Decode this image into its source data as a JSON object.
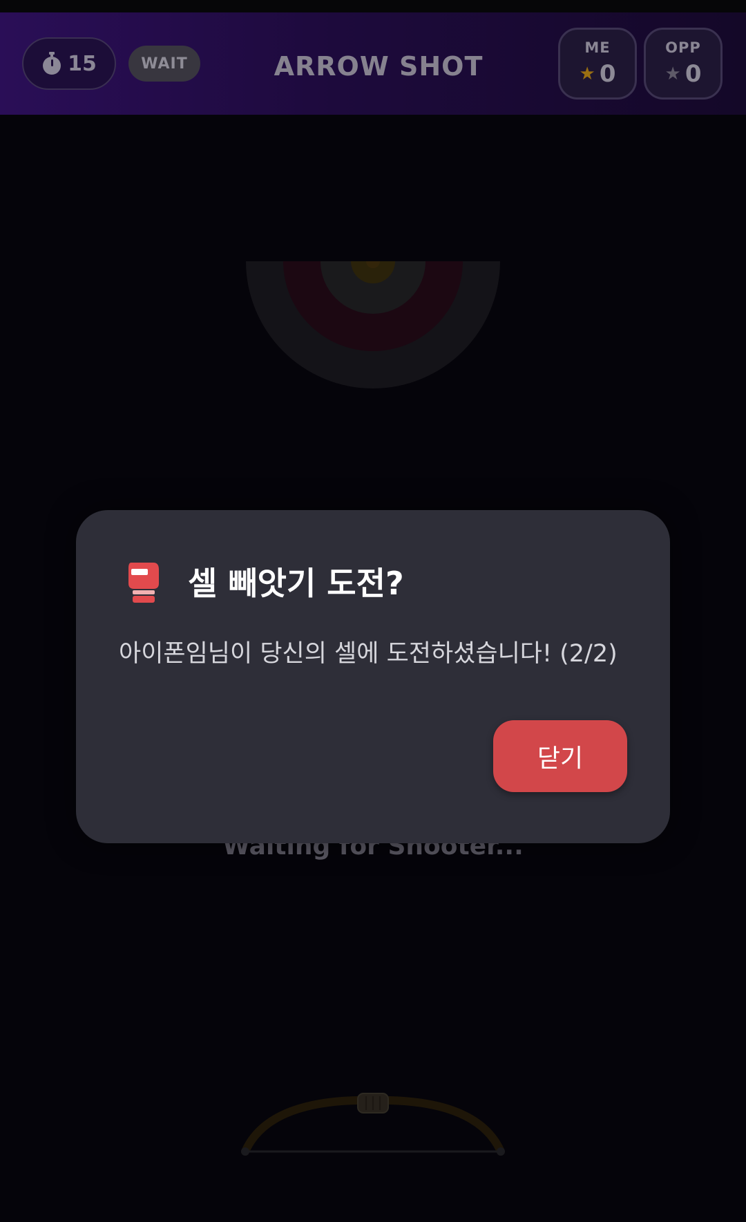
{
  "header": {
    "timer": "15",
    "status": "WAIT",
    "title": "ARROW SHOT",
    "scores": {
      "me": {
        "label": "ME",
        "value": "0"
      },
      "opp": {
        "label": "OPP",
        "value": "0"
      }
    }
  },
  "game": {
    "waiting_text": "Waiting for Shooter..."
  },
  "modal": {
    "icon": "boxing-glove-icon",
    "title": "셀 빼앗기 도전?",
    "message": "아이폰임님이 당신의 셀에 도전하셨습니다! (2/2)",
    "close_label": "닫기"
  },
  "colors": {
    "header_bg": "#2a0e57",
    "modal_bg": "#2e2e38",
    "close_button": "#d2474a",
    "star_me": "#9a6f12",
    "star_opp": "#5e5a68"
  },
  "icons": [
    "stopwatch-icon",
    "star-icon",
    "target-icon",
    "bow-icon",
    "boxing-glove-icon"
  ]
}
